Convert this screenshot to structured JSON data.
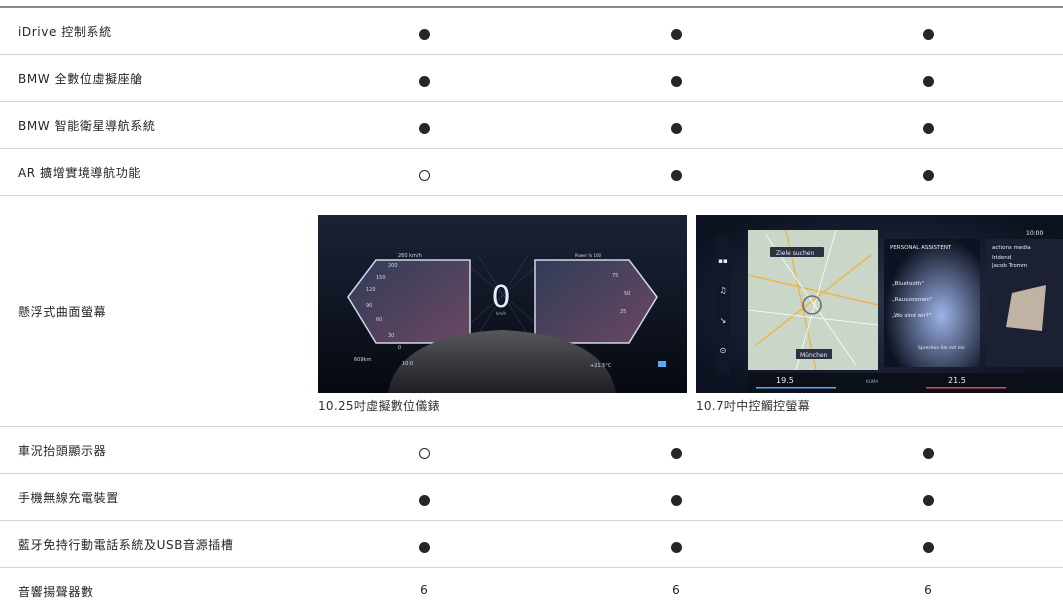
{
  "rows": [
    {
      "label": "iDrive 控制系統",
      "values": [
        "●",
        "●",
        "●"
      ]
    },
    {
      "label": "BMW 全數位虛擬座艙",
      "values": [
        "●",
        "●",
        "●"
      ]
    },
    {
      "label": "BMW 智能衛星導航系統",
      "values": [
        "●",
        "●",
        "●"
      ]
    },
    {
      "label": "AR 擴增實境導航功能",
      "values": [
        "○",
        "●",
        "●"
      ]
    }
  ],
  "screen_row": {
    "label": "懸浮式曲面螢幕",
    "cluster": {
      "caption": "10.25吋虛擬數位儀錶",
      "speed": "0",
      "speed_unit": "km/h",
      "max_speed": "260 km/h",
      "ticks": [
        "200",
        "150",
        "120",
        "90",
        "60",
        "30",
        "0"
      ],
      "power_label": "Power % 100",
      "power_ticks": [
        "75",
        "50",
        "25"
      ],
      "range": "609km",
      "time": "10:0",
      "temp": "+21.5°C",
      "gear": "D"
    },
    "center": {
      "caption": "10.7吋中控觸控螢幕",
      "search_placeholder": "Ziele suchen",
      "city": "München",
      "assistant_title": "PERSONAL ASSISTENT",
      "assistant_items": [
        "„Bluetooth\"",
        "„Rauszoomen\"",
        "„Wo sind wir?\""
      ],
      "assistant_hint": "Sprechen Sie mit mir",
      "media_title": "actions media",
      "media_line1": "Iridend",
      "media_line2": "Jacob Tromm",
      "clock": "10:00",
      "temp_left": "19.5",
      "temp_right": "21.5",
      "climate_label": "KLIMA"
    }
  },
  "rows_after": [
    {
      "label": "車況抬頭顯示器",
      "values": [
        "○",
        "●",
        "●"
      ]
    },
    {
      "label": "手機無線充電裝置",
      "values": [
        "●",
        "●",
        "●"
      ]
    },
    {
      "label": "藍牙免持行動電話系統及USB音源插槽",
      "values": [
        "●",
        "●",
        "●"
      ]
    },
    {
      "label": "音響揚聲器數",
      "values": [
        "6",
        "6",
        "6"
      ]
    }
  ],
  "colors": {
    "text": "#262626",
    "divider": "#d4d4d4",
    "top_rule": "#8a8a8a",
    "screen_bg": "#0b0f18",
    "accent_blue": "#5aa8ff",
    "accent_red": "#e0455c"
  }
}
